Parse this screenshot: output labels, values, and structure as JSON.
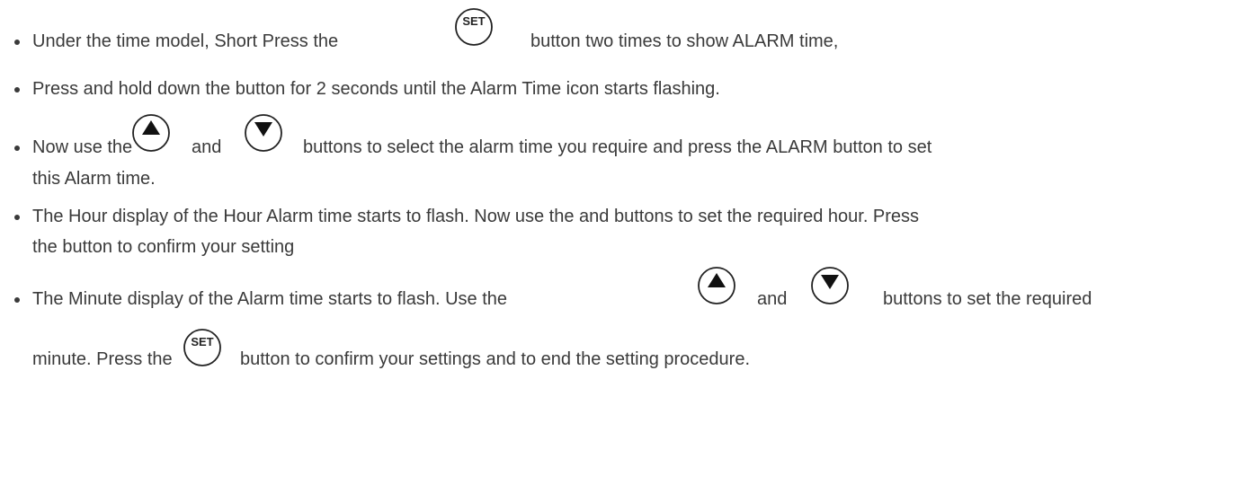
{
  "items": [
    {
      "before": "Under the time model, Short Press the",
      "after": "button two times to show ALARM time,"
    },
    {
      "text": "Press and hold down the button for 2 seconds until the Alarm Time icon starts flashing."
    },
    {
      "before": "Now use the",
      "between": "and",
      "after": "buttons to select the alarm time you require and press the ALARM button to set",
      "cont": "this Alarm time."
    },
    {
      "text": "The Hour display of the Hour Alarm time starts to flash. Now use the and buttons to set the required hour. Press",
      "cont": "the button to confirm your setting"
    },
    {
      "before": "The Minute display of the Alarm time starts to flash. Use the",
      "between": "and",
      "after": "buttons to set the required",
      "cont_before": "minute. Press the",
      "cont_after": "button to confirm your settings and to end the setting procedure."
    }
  ],
  "icons": {
    "set_label": "SET",
    "up": "up-arrow-button-icon",
    "down": "down-arrow-button-icon"
  },
  "colors": {
    "text": "#3a3a3a",
    "icon": "#222222"
  }
}
